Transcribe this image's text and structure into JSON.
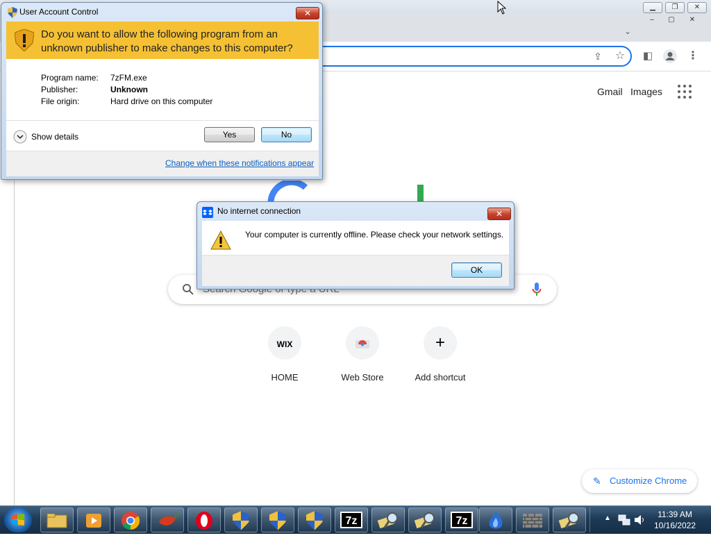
{
  "chrome": {
    "links": {
      "gmail": "Gmail",
      "images": "Images"
    },
    "search": {
      "placeholder": "Search Google or type a URL"
    },
    "shortcuts": [
      {
        "label": "HOME",
        "icon_text": "WIX"
      },
      {
        "label": "Web Store"
      },
      {
        "label": "Add shortcut",
        "icon_text": "+"
      }
    ],
    "customize_label": "Customize Chrome"
  },
  "uac": {
    "title": "User Account Control",
    "question": "Do you want to allow the following program from an unknown publisher to make changes to this computer?",
    "fields": [
      {
        "label": "Program name:",
        "value": "7zFM.exe"
      },
      {
        "label": "Publisher:",
        "value": "Unknown"
      },
      {
        "label": "File origin:",
        "value": "Hard drive on this computer"
      }
    ],
    "show_details": "Show details",
    "yes": "Yes",
    "no": "No",
    "change_link": "Change when these notifications appear",
    "close": "✕"
  },
  "offline_dialog": {
    "title": "No internet connection",
    "message": "Your computer is currently offline. Please check your network settings.",
    "ok": "OK",
    "close": "✕"
  },
  "taskbar": {
    "apps": [
      "file-explorer",
      "media-player",
      "chrome",
      "pepper-app",
      "opera",
      "uac-shield",
      "uac-shield",
      "uac-shield",
      "7zip",
      "magnifier-tool",
      "magnifier-tool",
      "7zip",
      "blue-app",
      "firewall",
      "magnifier-tool"
    ],
    "icons_7z": "7z",
    "clock_time": "11:39 AM",
    "clock_date": "10/16/2022"
  },
  "colors": {
    "uac_banner": "#f5c033",
    "accent_blue": "#1a73e8",
    "close_red": "#c8402a"
  }
}
